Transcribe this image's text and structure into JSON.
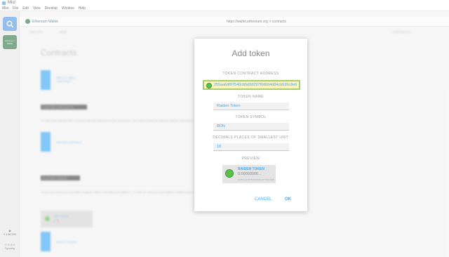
{
  "window": {
    "title": "Mist"
  },
  "menu": [
    "Mist",
    "File",
    "Edit",
    "View",
    "Develop",
    "Window",
    "Help"
  ],
  "sidebar": {
    "wallet_tile_label": "Ethereum Wallet",
    "balance": "0.198,555",
    "peers": "2",
    "block": "0",
    "sync": "Syncing"
  },
  "addressbar": {
    "tab_label": "Ethereum Wallet",
    "url": "https://wallet.ethereum.org",
    "url_path": " > contracts"
  },
  "background": {
    "nav": [
      "WALLETS",
      "SEND",
      "CONTRACTS"
    ],
    "heading": "Contracts",
    "deploy_label": "DEPLOY NEW CONTRACT",
    "custom_contracts": "CUSTOM CONTRACTS",
    "custom_contracts_text": "To watch and interact with a contract already deployed on the blockchain, you need to know its address and the description of its interface in JSON format.",
    "watch_contract_label": "WATCH CONTRACT",
    "custom_tokens": "CUSTOM TOKENS",
    "custom_tokens_text": "Tokens are currencies and other fungibles built on the Ethereum platform. In order for accounts and wallets to follow tokens, you need to add them.",
    "token_card_name": "UNICORNS",
    "token_card_amount": "0 🦄",
    "watch_token_label": "WATCH TOKEN"
  },
  "modal": {
    "title": "Add token",
    "address_label": "TOKEN CONTRACT ADDRESS",
    "address_value": "255aa6df07540cb5d3d297f0d0d4d84cb52bc8e6",
    "name_label": "TOKEN NAME",
    "name_value": "Raiden Token",
    "symbol_label": "TOKEN SYMBOL",
    "symbol_value": "RDN",
    "decimals_label": "DECIMALS PLACES OF SMALLEST UNIT",
    "decimals_value": "18",
    "preview_label": "PREVIEW",
    "preview_name": "RAIDEN TOKEN",
    "preview_amount": "0.00000000...",
    "preview_sub": "0x255aa6df07540cb5d3d297f0d0d4d84cb52bc8e6",
    "cancel_label": "CANCEL",
    "ok_label": "OK"
  },
  "colors": {
    "accent": "#3fa9f5",
    "identicon": "#5bbf4c",
    "highlight": "#fff3c4",
    "focus_border": "#a8cf6a"
  }
}
